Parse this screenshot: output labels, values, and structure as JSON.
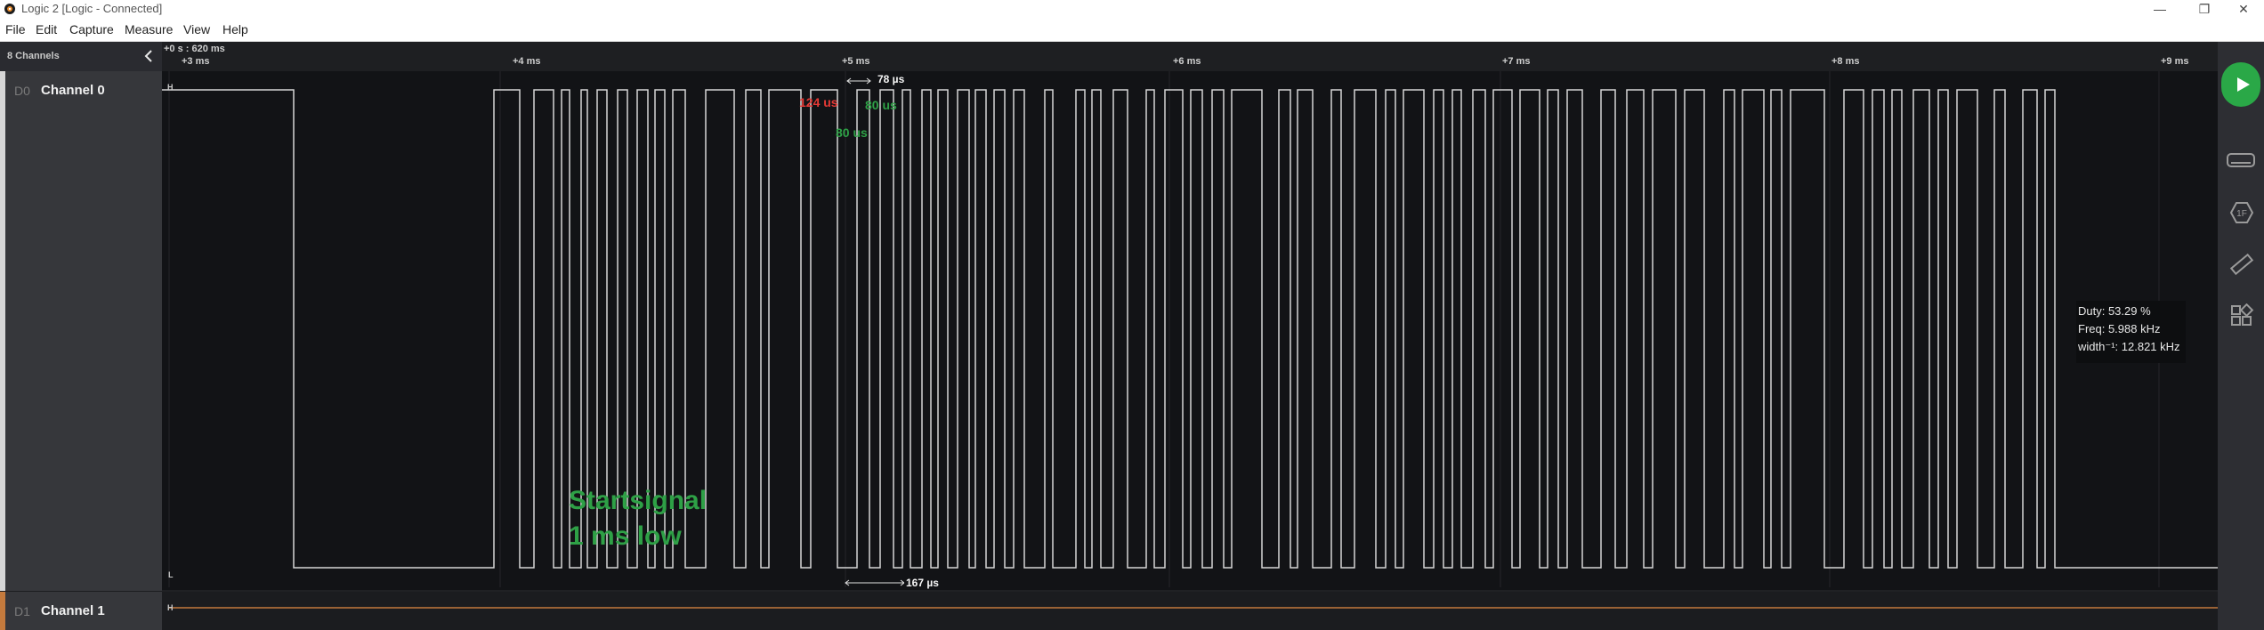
{
  "window": {
    "title": "Logic 2 [Logic - Connected]",
    "minimize_glyph": "—",
    "restore_glyph": "❐",
    "close_glyph": "✕"
  },
  "menu": [
    "File",
    "Edit",
    "Capture",
    "Measure",
    "View",
    "Help"
  ],
  "sidebar": {
    "channel_count_label": "8 Channels"
  },
  "timeline": {
    "origin_label": "+0 s : 620 ms",
    "ticks": [
      "+3 ms",
      "+4 ms",
      "+5 ms",
      "+6 ms",
      "+7 ms",
      "+8 ms",
      "+9 ms"
    ]
  },
  "channels": [
    {
      "code": "D0",
      "name": "Channel 0",
      "high_marker": "H",
      "low_marker": "L",
      "color": "#d6d6d6"
    },
    {
      "code": "D1",
      "name": "Channel 1",
      "high_marker": "H",
      "color": "#c47a3d"
    }
  ],
  "annotations": {
    "title": "Startsignal",
    "subtitle": "1 ms low",
    "color": "#2ea046"
  },
  "measurements": {
    "label_124": "124 us",
    "label_80a": "80 us",
    "label_80b": "80 us",
    "width_top": "78 µs",
    "width_bottom": "167 µs",
    "red_color": "#e53935",
    "green_color": "#2ea046"
  },
  "tooltip": {
    "duty": "Duty: 53.29 %",
    "freq": "Freq: 5.988 kHz",
    "width": "width⁻¹: 12.821 kHz"
  },
  "rail_icons": [
    "play-icon",
    "analyzer-icon",
    "trigger-icon",
    "measure-icon",
    "extensions-icon"
  ]
}
